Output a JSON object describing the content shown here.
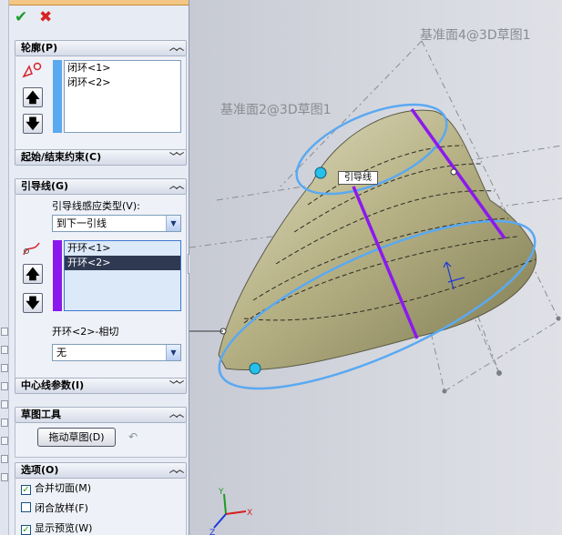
{
  "panel": {
    "ok_label": "✔",
    "cancel_label": "✖",
    "profiles": {
      "title": "轮廓(P)",
      "items": [
        "闭环<1>",
        "闭环<2>"
      ],
      "bar_color": "#5aa9f1"
    },
    "start_end": {
      "title": "起始/结束约束(C)"
    },
    "guides": {
      "title": "引导线(G)",
      "influence_label": "引导线感应类型(V):",
      "influence_value": "到下一引线",
      "items": [
        "开环<1>",
        "开环<2>"
      ],
      "selected_index": 1,
      "bar_color": "#8b19ee",
      "tangency_label": "开环<2>-相切",
      "tangency_value": "无"
    },
    "centerline": {
      "title": "中心线参数(I)"
    },
    "sketch_tools": {
      "title": "草图工具",
      "drag_button": "拖动草图(D)"
    },
    "options": {
      "title": "选项(O)",
      "checkboxes": [
        {
          "label": "合并切面(M)",
          "checked": true
        },
        {
          "label": "闭合放样(F)",
          "checked": false
        },
        {
          "label": "显示预览(W)",
          "checked": true
        }
      ]
    }
  },
  "viewport": {
    "plane4_label": "基准面4@3D草图1",
    "plane2_label": "基准面2@3D草图1",
    "callout_label": "引导线",
    "body_color": "#b8b387",
    "edge_color": "#5aa9f1",
    "guide_color": "#8b19ee"
  }
}
